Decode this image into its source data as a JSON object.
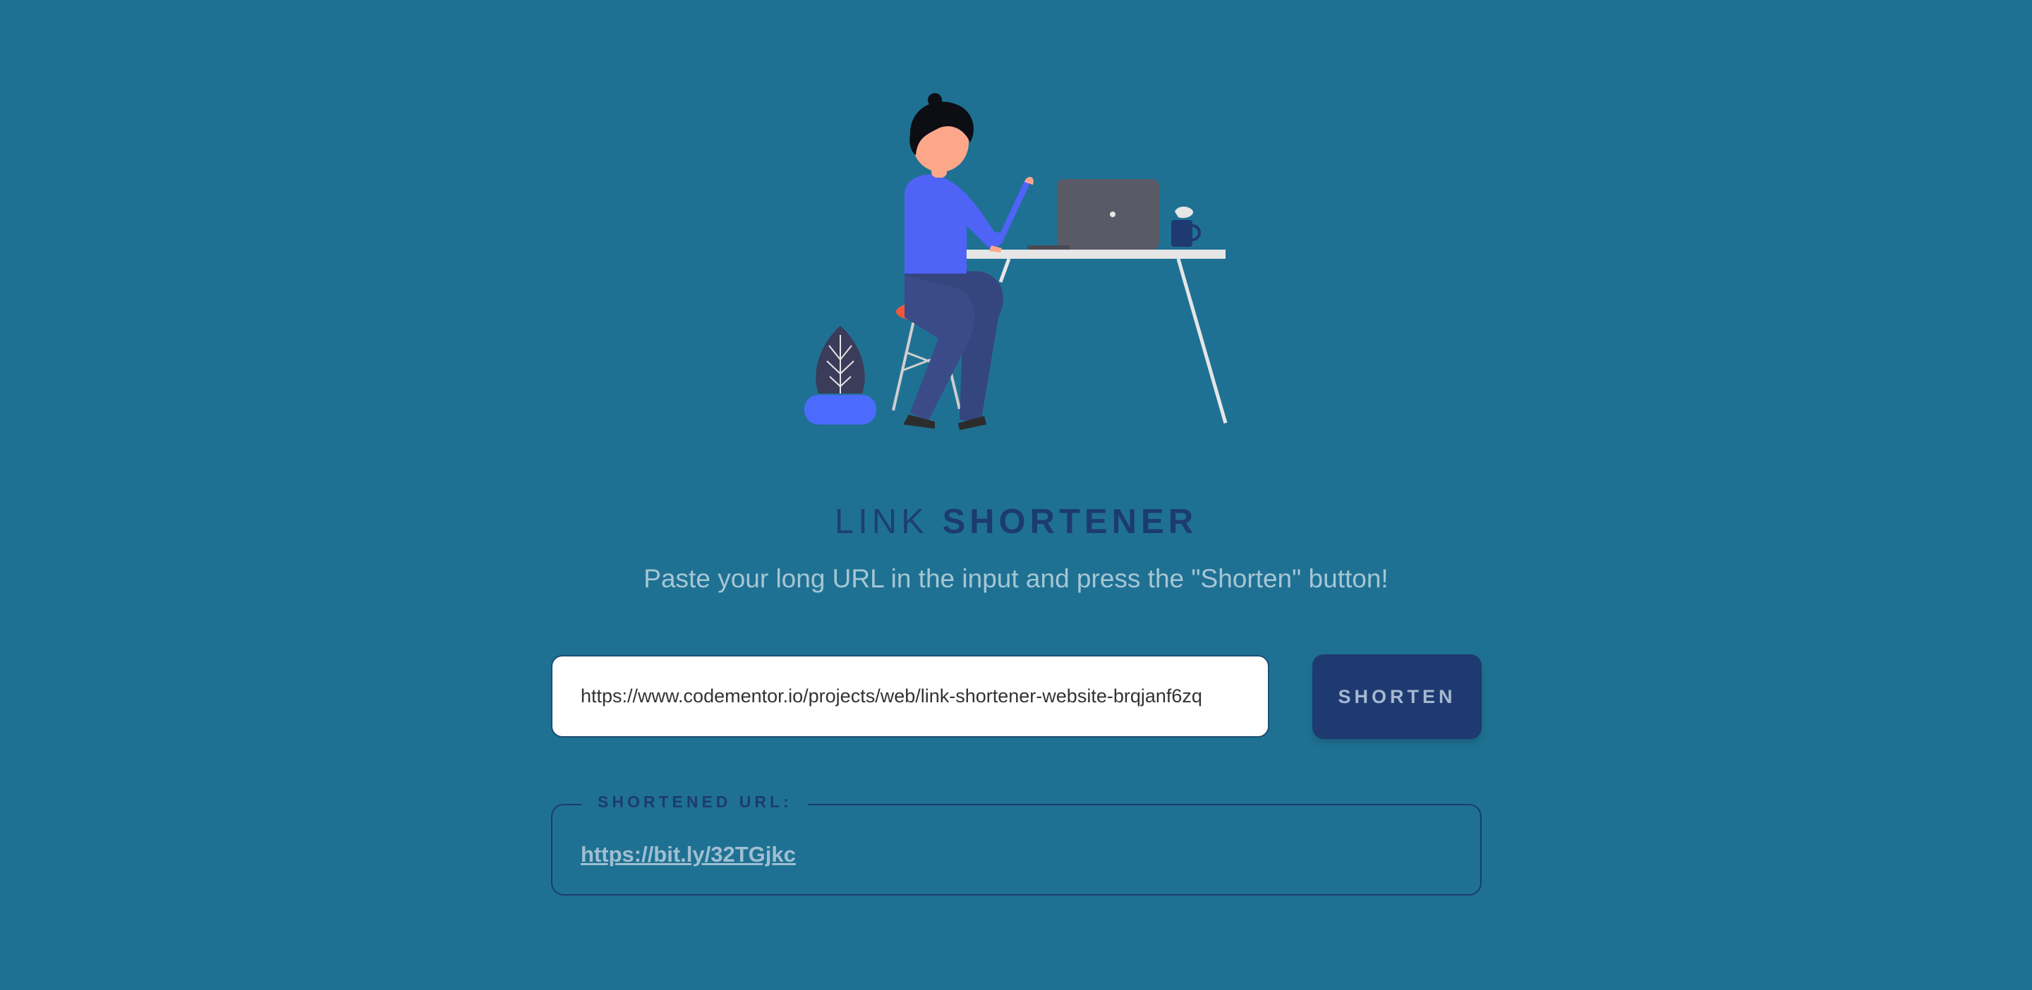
{
  "header": {
    "title_light": "LINK",
    "title_bold": "SHORTENER",
    "subtitle": "Paste your long URL in the input and press the \"Shorten\" button!"
  },
  "form": {
    "url_value": "https://www.codementor.io/projects/web/link-shortener-website-brqjanf6zq",
    "shorten_label": "SHORTEN"
  },
  "result": {
    "legend": "SHORTENED URL:",
    "short_url": "https://bit.ly/32TGjkc"
  },
  "colors": {
    "background": "#1f7193",
    "accent": "#1e3a70",
    "muted_text": "#a6c6d3"
  },
  "icons": {
    "illustration": "person-at-desk-illustration"
  }
}
